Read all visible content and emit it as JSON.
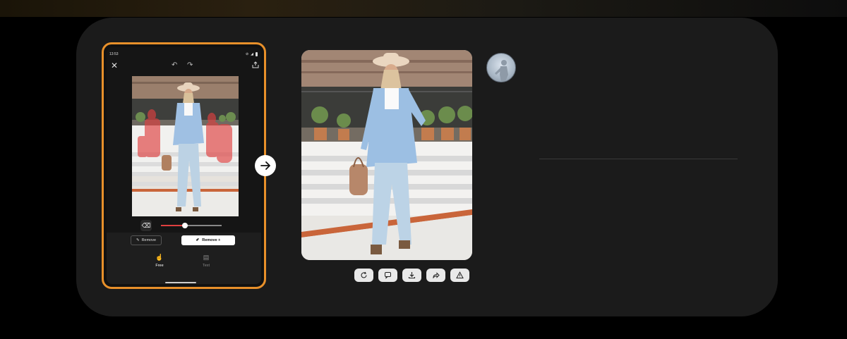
{
  "phone": {
    "status_time": "13:53",
    "tool_buttons": {
      "remove_label": "Remove",
      "remove_plus_label": "Remove +"
    },
    "modes": [
      {
        "label": "Free",
        "icon": "hand-pointer-icon",
        "active": true
      },
      {
        "label": "Text",
        "icon": "text-box-icon",
        "active": false
      }
    ],
    "brush_size_fraction": 0.4
  },
  "result_actions": [
    {
      "icon": "regenerate-icon"
    },
    {
      "icon": "feedback-icon"
    },
    {
      "icon": "download-icon"
    },
    {
      "icon": "share-icon"
    },
    {
      "icon": "report-icon"
    }
  ],
  "colors": {
    "accent": "#e8902a",
    "card": "#1b1b1b",
    "mask": "#e04040"
  }
}
